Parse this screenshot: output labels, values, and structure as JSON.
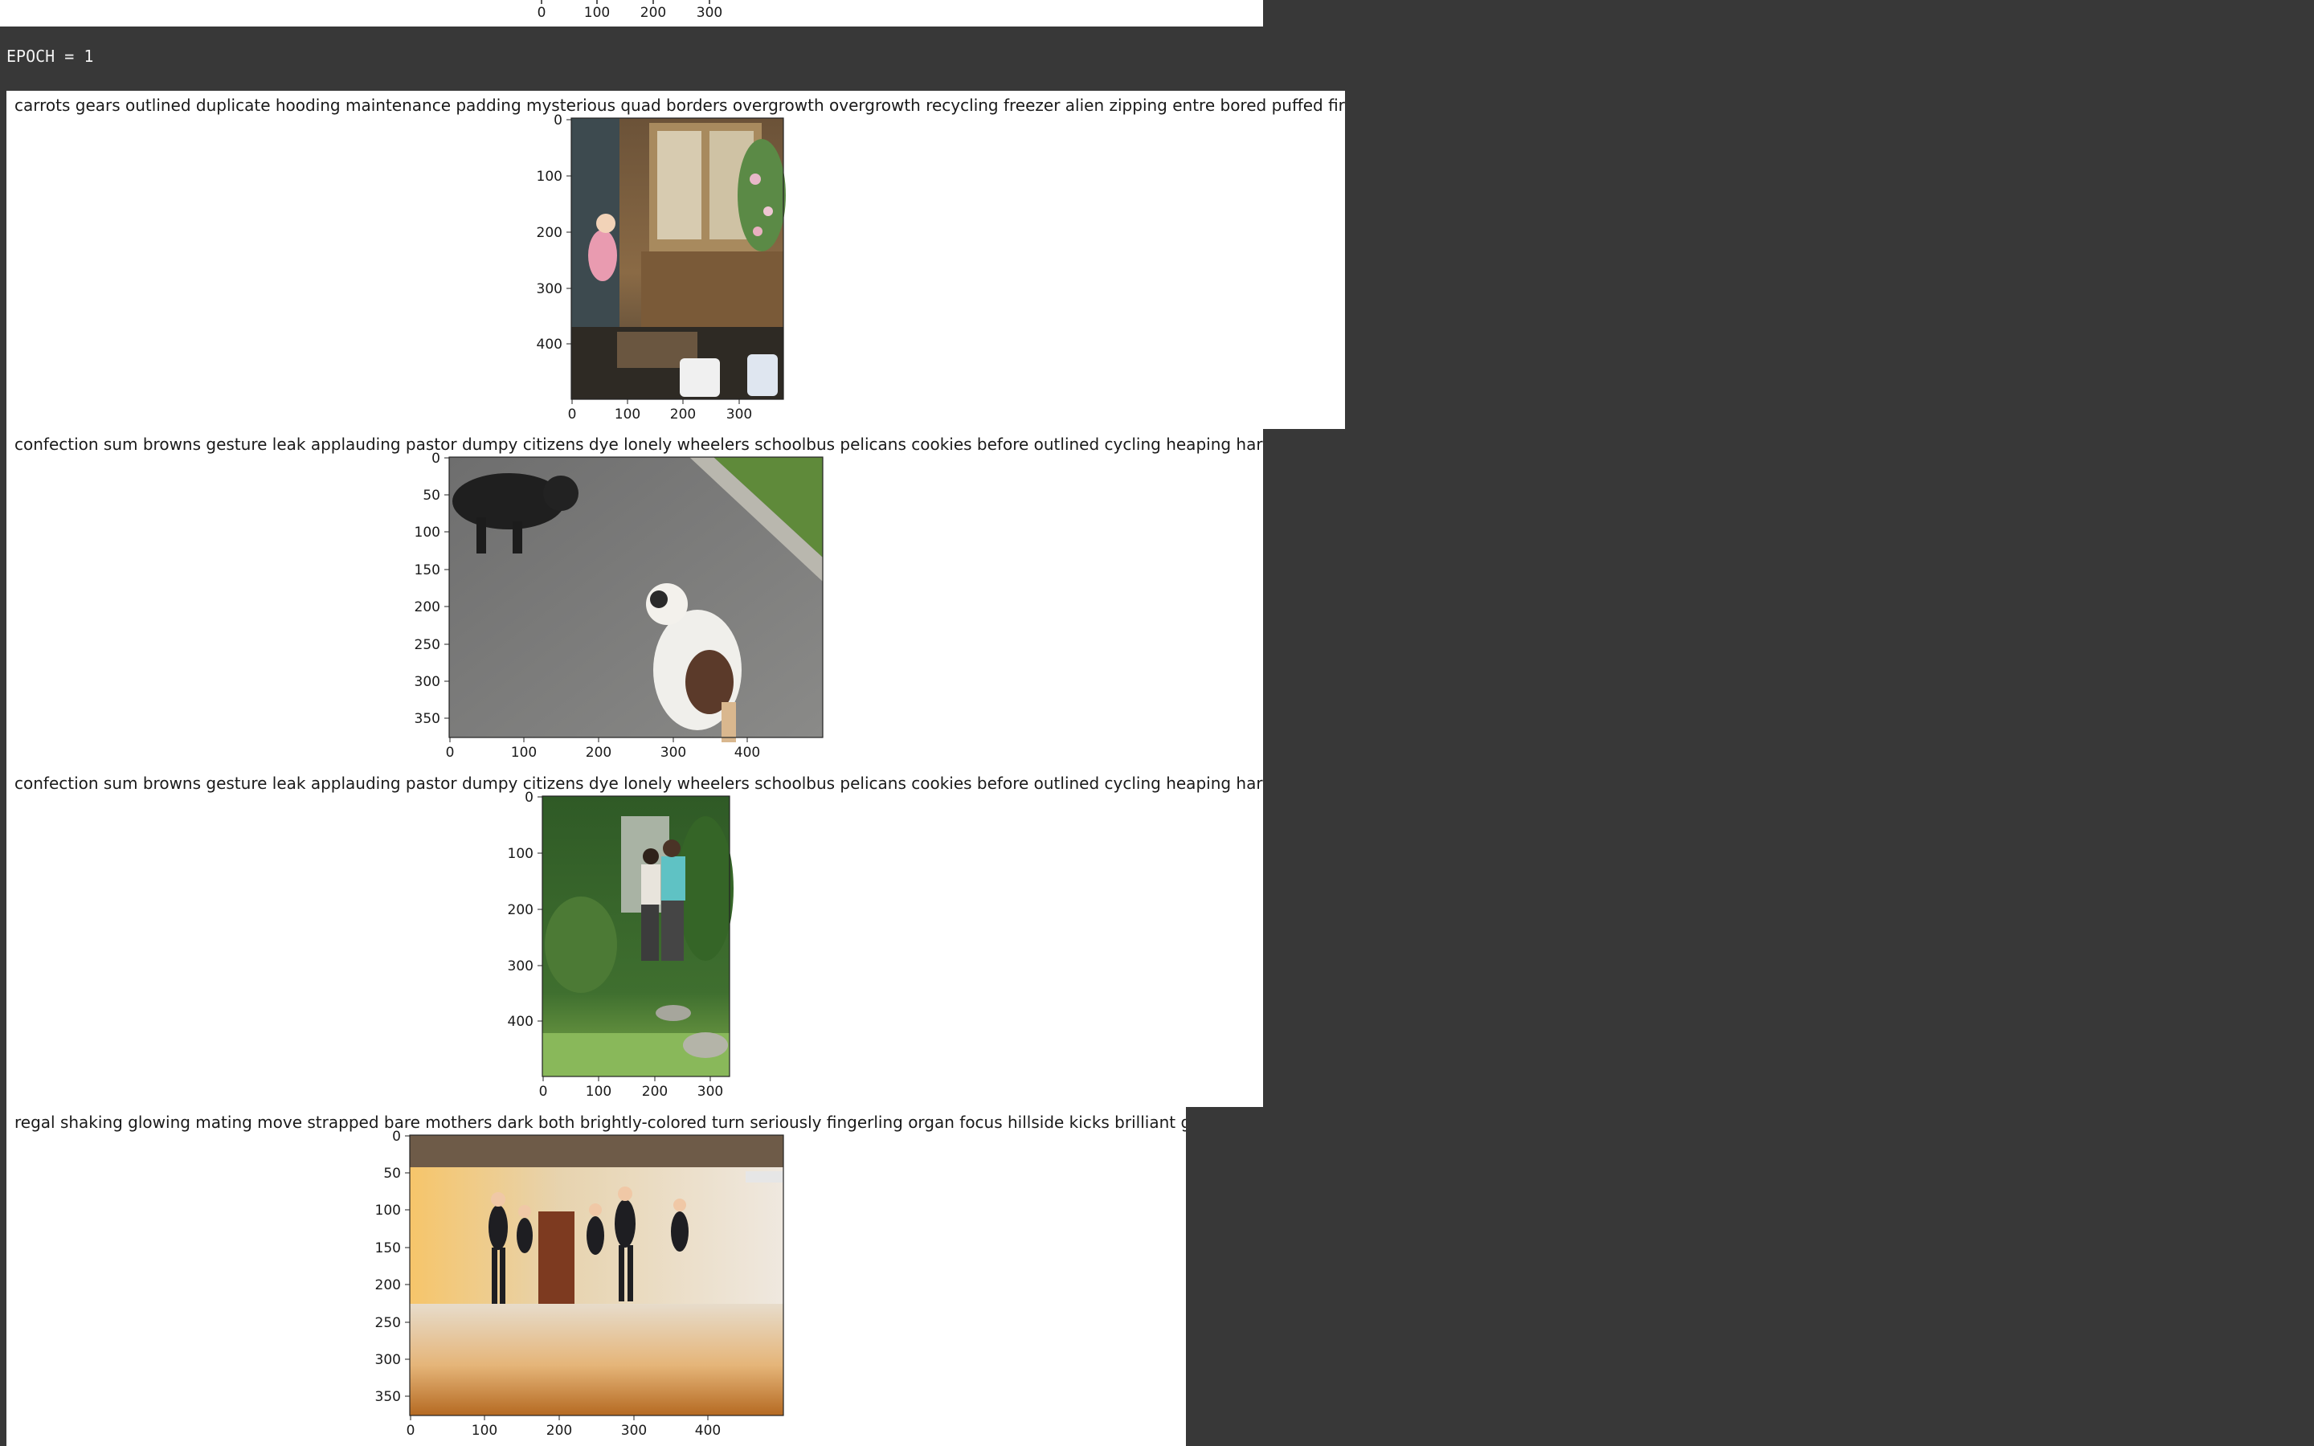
{
  "epoch_label": "EPOCH = 1",
  "colors": {
    "background": "#383838",
    "output_panel": "#ffffff",
    "epoch_text": "#f2f2f2"
  },
  "top_partial_plot": {
    "x_ticks": [
      "0",
      "100",
      "200",
      "300"
    ]
  },
  "outputs": [
    {
      "caption": "carrots gears outlined duplicate hooding maintenance padding mysterious quad borders overgrowth overgrowth recycling freezer alien zipping entre bored puffed firsbee",
      "image": "girl in pink dress climbing steps of a wooden playhouse",
      "x_ticks": [
        "0",
        "100",
        "200",
        "300"
      ],
      "y_ticks": [
        "0",
        "100",
        "200",
        "300",
        "400"
      ]
    },
    {
      "caption": "confection sum browns gesture leak applauding pastor dumpy citizens dye lonely wheelers schoolbus pelicans cookies before outlined cycling heaping harbour",
      "image": "black dog and white-and-brown dog playing on a paved road",
      "x_ticks": [
        "0",
        "100",
        "200",
        "300",
        "400"
      ],
      "y_ticks": [
        "0",
        "50",
        "100",
        "150",
        "200",
        "250",
        "300",
        "350"
      ]
    },
    {
      "caption": "confection sum browns gesture leak applauding pastor dumpy citizens dye lonely wheelers schoolbus pelicans cookies before outlined cycling heaping harbour",
      "image": "two people standing in a garden path surrounded by green bushes",
      "x_ticks": [
        "0",
        "100",
        "200",
        "300"
      ],
      "y_ticks": [
        "0",
        "100",
        "200",
        "300",
        "400"
      ]
    },
    {
      "caption": "regal shaking glowing mating move strapped bare mothers dark both brightly-colored turn seriously fingerling organ focus hillside kicks brilliant gyro",
      "image": "ballet dancers in black leotards jumping in a sunlit dance studio",
      "x_ticks": [
        "0",
        "100",
        "200",
        "300",
        "400"
      ],
      "y_ticks": [
        "0",
        "50",
        "100",
        "150",
        "200",
        "250",
        "300",
        "350"
      ]
    }
  ]
}
